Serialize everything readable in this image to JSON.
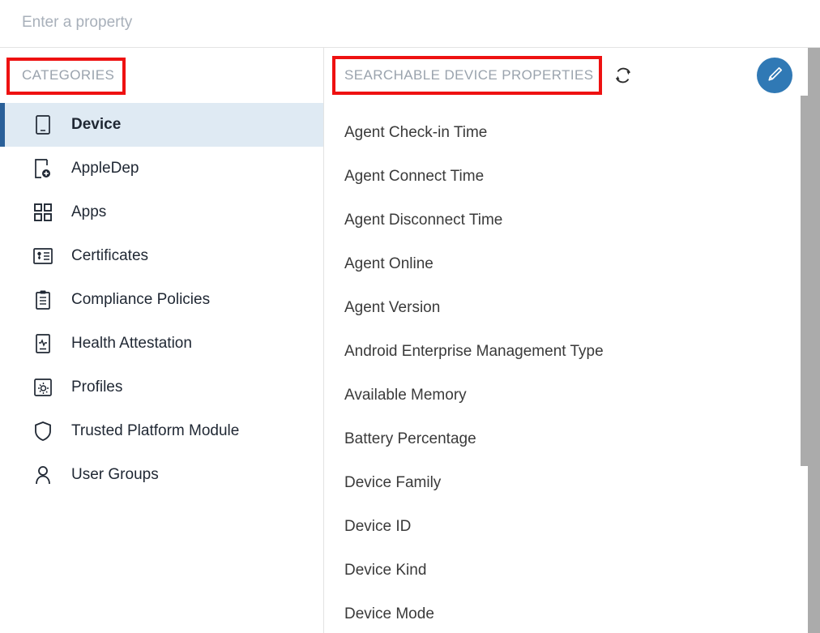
{
  "search": {
    "placeholder": "Enter a property",
    "value": ""
  },
  "left_pane": {
    "header": "CATEGORIES",
    "items": [
      {
        "label": "Device",
        "icon": "phone-icon",
        "selected": true
      },
      {
        "label": "AppleDep",
        "icon": "device-add-icon",
        "selected": false
      },
      {
        "label": "Apps",
        "icon": "grid-icon",
        "selected": false
      },
      {
        "label": "Certificates",
        "icon": "id-card-icon",
        "selected": false
      },
      {
        "label": "Compliance Policies",
        "icon": "clipboard-icon",
        "selected": false
      },
      {
        "label": "Health Attestation",
        "icon": "heartbeat-icon",
        "selected": false
      },
      {
        "label": "Profiles",
        "icon": "gear-box-icon",
        "selected": false
      },
      {
        "label": "Trusted Platform Module",
        "icon": "shield-icon",
        "selected": false
      },
      {
        "label": "User Groups",
        "icon": "user-icon",
        "selected": false
      }
    ]
  },
  "right_pane": {
    "header": "SEARCHABLE DEVICE PROPERTIES",
    "refresh_icon": "refresh-icon",
    "edit_icon": "pencil-icon",
    "properties": [
      "Agent Check-in Time",
      "Agent Connect Time",
      "Agent Disconnect Time",
      "Agent Online",
      "Agent Version",
      "Android Enterprise Management Type",
      "Available Memory",
      "Battery Percentage",
      "Device Family",
      "Device ID",
      "Device Kind",
      "Device Mode"
    ]
  },
  "colors": {
    "accent_blue": "#2a6099",
    "selected_row_bg": "#dfeaf3",
    "edit_button_bg": "#3079b5",
    "annotation_red": "#ee1111",
    "header_text": "#9aa3ad",
    "scrollbar": "#ababab"
  }
}
